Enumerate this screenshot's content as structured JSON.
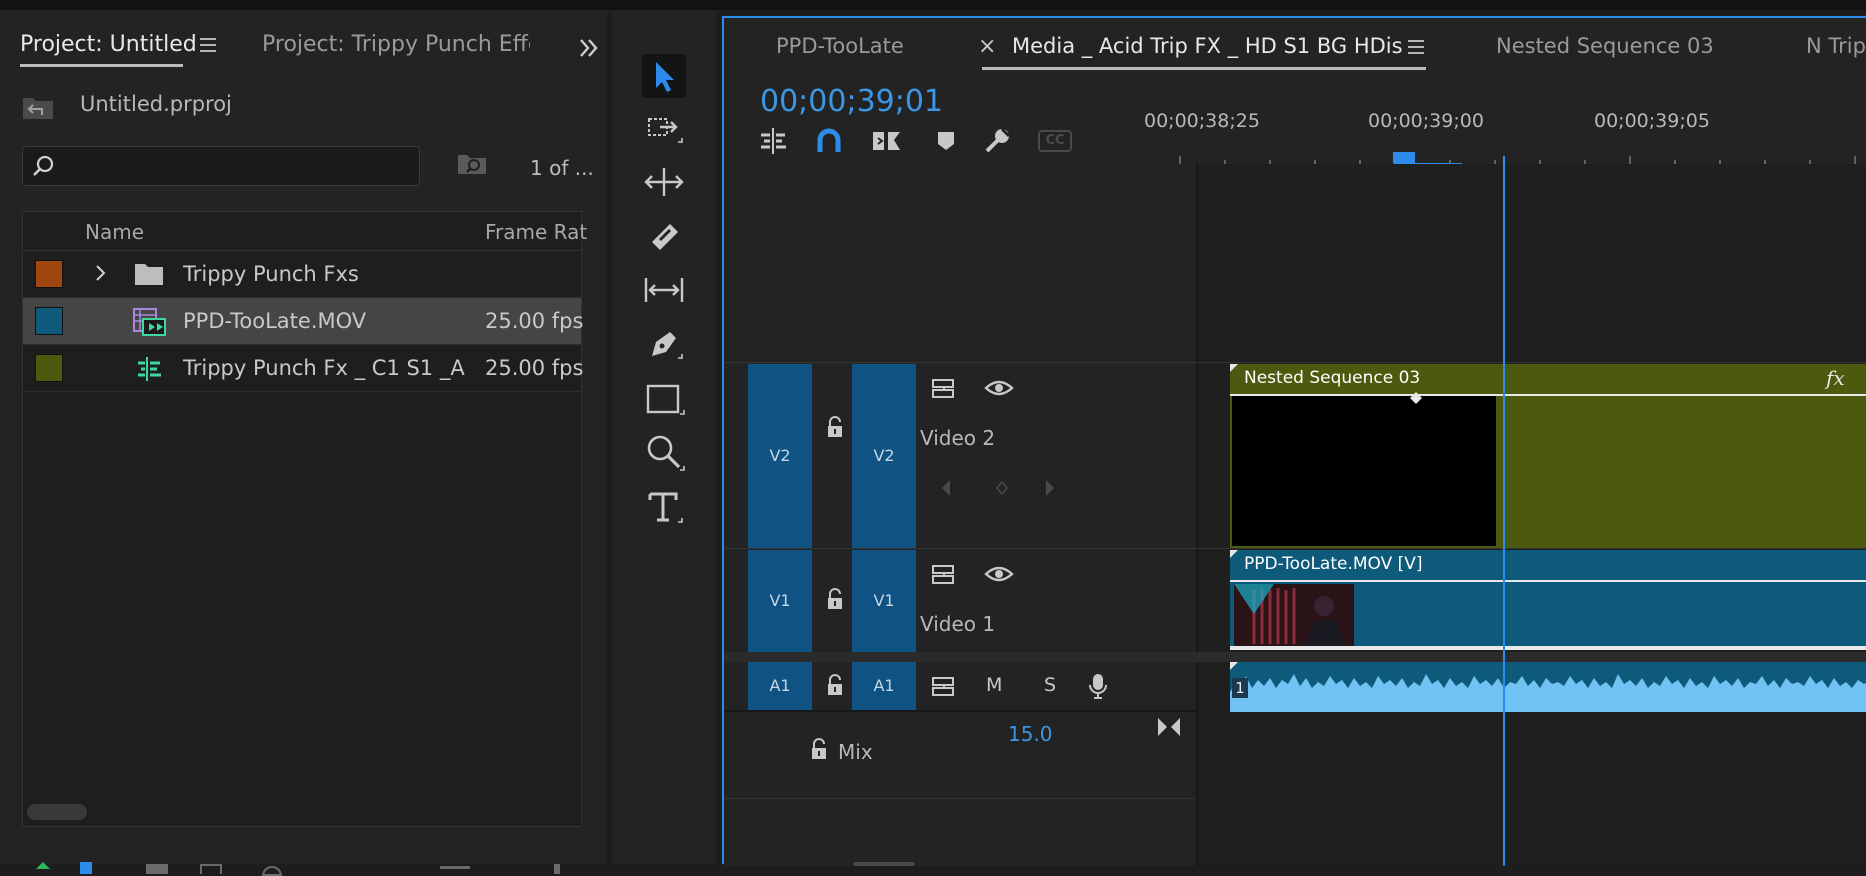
{
  "project_panel": {
    "tabs": [
      {
        "label": "Project: Untitled",
        "active": true
      },
      {
        "label": "Project: Trippy Punch Effect",
        "active": false
      }
    ],
    "overflow_icon": "double-chevron-right-icon",
    "file_name": "Untitled.prproj",
    "search": {
      "value": "",
      "placeholder": ""
    },
    "item_count": "1 of ...",
    "columns": [
      "Name",
      "Frame Rat"
    ],
    "items": [
      {
        "name": "Trippy Punch Fxs",
        "fps": "",
        "type": "folder",
        "label_color": "#a0470f",
        "expandable": true,
        "selected": false
      },
      {
        "name": "PPD-TooLate.MOV",
        "fps": "25.00 fps",
        "type": "video-audio-clip",
        "label_color": "#0d5a7a",
        "expandable": false,
        "selected": true
      },
      {
        "name": "Trippy Punch Fx _ C1 S1 _A",
        "fps": "25.00 fps",
        "type": "sequence",
        "label_color": "#4b5a0e",
        "expandable": false,
        "selected": false
      }
    ]
  },
  "tools": [
    "selection-tool",
    "track-select-forward-tool",
    "ripple-edit-tool",
    "razor-tool",
    "slip-tool",
    "pen-tool",
    "rectangle-tool",
    "hand-zoom-tool",
    "type-tool"
  ],
  "timeline": {
    "tabs": [
      {
        "label": "PPD-TooLate",
        "active": false
      },
      {
        "label": "Media _ Acid Trip FX _ HD S1 BG HDis",
        "active": true
      },
      {
        "label": "Nested Sequence 03",
        "active": false
      },
      {
        "label": "N Trip",
        "active": false
      }
    ],
    "timecode": "00;00;39;01",
    "ruler_labels": [
      "00;00;38;25",
      "00;00;39;00",
      "00;00;39;05"
    ],
    "cc_label": "CC",
    "tracks": {
      "v2": {
        "source": "V2",
        "target": "V2",
        "name": "Video 2"
      },
      "v1": {
        "source": "V1",
        "target": "V1",
        "name": "Video 1"
      },
      "a1": {
        "source": "A1",
        "target": "A1",
        "mute": "M",
        "solo": "S"
      }
    },
    "mix": {
      "label": "Mix",
      "value": "15.0"
    },
    "clips": {
      "nested": {
        "title": "Nested Sequence 03",
        "fx": "fx"
      },
      "video": {
        "title": "PPD-TooLate.MOV [V]"
      },
      "audio": {
        "channel": "1"
      }
    },
    "colors": {
      "accent": "#2d8ceb",
      "timecode": "#3b97e3",
      "work_area": "#e5d31a",
      "nested_clip": "#4b5a0e",
      "video_clip": "#0d5a7a",
      "audio_wave": "#6fc2f2",
      "track_button": "#0e5383"
    }
  }
}
